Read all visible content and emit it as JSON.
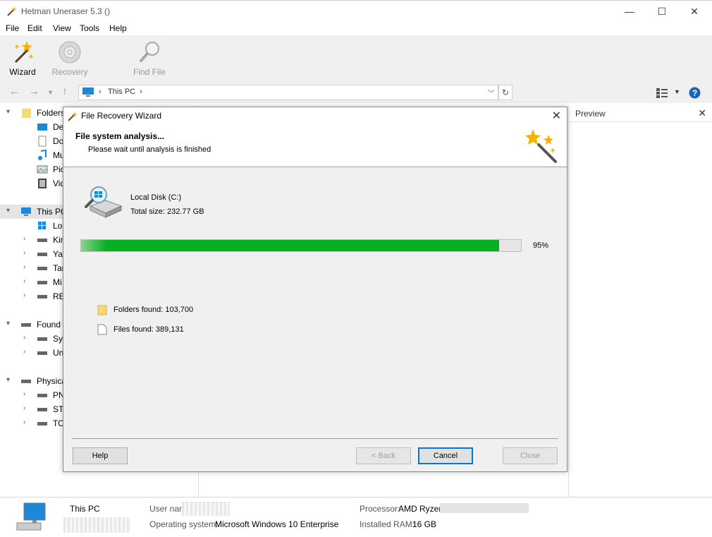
{
  "window": {
    "title": "Hetman Uneraser 5.3 ()",
    "minimize": "—",
    "maximize": "☐",
    "close": "✕"
  },
  "menu": [
    "File",
    "Edit",
    "View",
    "Tools",
    "Help"
  ],
  "toolbar": {
    "wizard": "Wizard",
    "recovery": "Recovery",
    "find_file": "Find File"
  },
  "address": {
    "crumb": "This PC",
    "sep1": "›",
    "sep2": "›",
    "refresh": "↻",
    "dropdown": "﹀"
  },
  "tree": {
    "folders_label": "Folders",
    "folders": [
      "De",
      "Do",
      "Mu",
      "Pic",
      "Vid"
    ],
    "this_pc": "This PC",
    "drives": [
      "Loc",
      "Kin",
      "Yai",
      "Tar",
      "Mi",
      "RE"
    ],
    "found_label": "Found",
    "found": [
      "Sys",
      "Un"
    ],
    "physical_label": "Physica",
    "physical": [
      "PN",
      "ST",
      "TO"
    ]
  },
  "preview": {
    "label": "Preview",
    "close": "✕"
  },
  "status": {
    "name": "This PC",
    "user_label": "User nam",
    "os_label": "Operating system:",
    "os_value": "Microsoft Windows 10 Enterprise",
    "cpu_label": "Processor:",
    "cpu_value": "AMD Ryzen",
    "ram_label": "Installed RAM:",
    "ram_value": "16 GB"
  },
  "dialog": {
    "title": "File Recovery Wizard",
    "close": "✕",
    "heading": "File system analysis...",
    "subheading": "Please wait until analysis is finished",
    "disk_name": "Local Disk (C:)",
    "disk_size": "Total size: 232.77 GB",
    "progress": 0.95,
    "progress_label": "95%",
    "folders_found": "Folders found: 103,700",
    "files_found": "Files found: 389,131",
    "buttons": {
      "help": "Help",
      "back": "< Back",
      "cancel": "Cancel",
      "close": "Close"
    }
  },
  "colors": {
    "progress_fill": "#06b025",
    "focus_border": "#0078d7"
  }
}
